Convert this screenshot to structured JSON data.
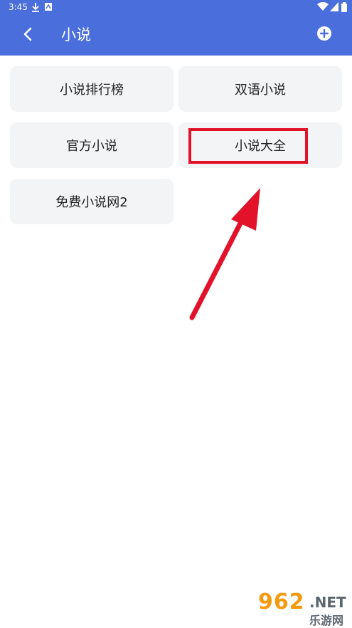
{
  "status_bar": {
    "time": "3:45"
  },
  "header": {
    "title": "小说"
  },
  "tiles": [
    {
      "label": "小说排行榜"
    },
    {
      "label": "双语小说"
    },
    {
      "label": "官方小说"
    },
    {
      "label": "小说大全"
    },
    {
      "label": "免费小说网2"
    }
  ],
  "annotation": {
    "highlight_color": "#e2122a"
  },
  "watermark": {
    "digits": "962",
    "suffix": ".NET",
    "cn": "乐游网"
  },
  "colors": {
    "header_bg": "#4a6fdc",
    "tile_bg": "#f3f4f6"
  }
}
